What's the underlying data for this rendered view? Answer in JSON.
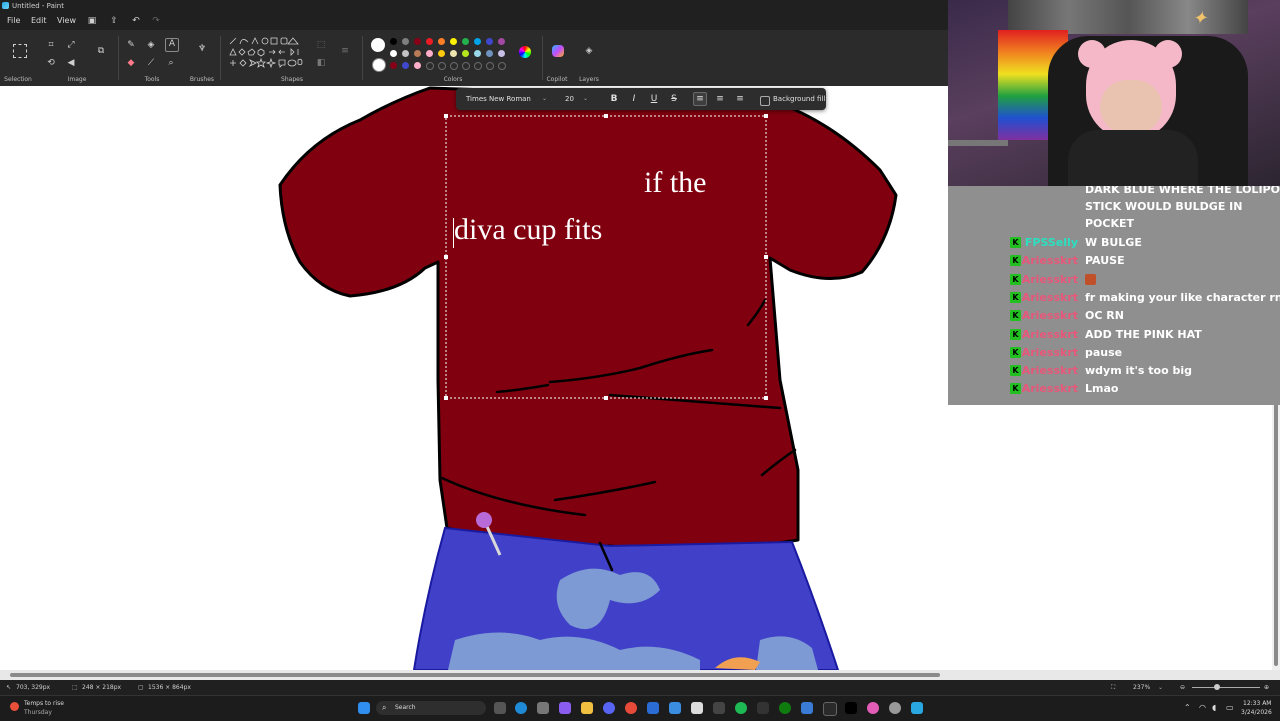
{
  "window": {
    "title": "Untitled - Paint"
  },
  "menu": {
    "file": "File",
    "edit": "Edit",
    "view": "View"
  },
  "ribbon": {
    "groups": {
      "selection": "Selection",
      "image": "Image",
      "tools": "Tools",
      "brushes": "Brushes",
      "shapes": "Shapes",
      "colors": "Colors",
      "copilot": "Copilot",
      "layers": "Layers"
    }
  },
  "palette": {
    "row1": [
      "#000000",
      "#7f7f7f",
      "#880015",
      "#ed1c24",
      "#ff7f27",
      "#fff200",
      "#22b14c",
      "#00a2e8",
      "#3f48cc",
      "#a349a4"
    ],
    "row2": [
      "#ffffff",
      "#c3c3c3",
      "#b97a57",
      "#ffaec9",
      "#ffc90e",
      "#efe4b0",
      "#b5e61d",
      "#99d9ea",
      "#7092be",
      "#c8bfe7"
    ],
    "row3": [
      "#880015",
      "#3f48cc",
      "#ffaec9"
    ]
  },
  "textbar": {
    "font": "Times New Roman",
    "size": "20",
    "background_fill": "Background fill"
  },
  "canvas": {
    "line1": "if the",
    "line2": "diva cup fits"
  },
  "status": {
    "cursor_pos": "703, 329px",
    "selection_size": "248 × 218px",
    "canvas_size": "1536 × 864px",
    "zoom": "237%"
  },
  "taskbar": {
    "weather_title": "Temps to rise",
    "weather_sub": "Thursday",
    "search": "Search",
    "time": "12:33 AM",
    "date": "3/24/2026"
  },
  "chat": {
    "continuation": [
      "DARK BLUE WHERE THE LOLIPOP",
      "STICK WOULD BULDGE IN",
      "POCKET"
    ],
    "messages": [
      {
        "user": "FPSSelly",
        "color": "#29e0c0",
        "text": "W BULGE"
      },
      {
        "user": "Ariesskrt",
        "color": "#e8577a",
        "text": "PAUSE"
      },
      {
        "user": "Ariesskrt",
        "color": "#e8577a",
        "text": ""
      },
      {
        "user": "Ariesskrt",
        "color": "#e8577a",
        "text": "fr making your like character rn"
      },
      {
        "user": "Ariesskrt",
        "color": "#e8577a",
        "text": "OC RN"
      },
      {
        "user": "Ariesskrt",
        "color": "#e8577a",
        "text": "ADD THE PINK HAT"
      },
      {
        "user": "Ariesskrt",
        "color": "#e8577a",
        "text": "pause"
      },
      {
        "user": "Ariesskrt",
        "color": "#e8577a",
        "text": "wdym it's too big"
      },
      {
        "user": "Ariesskrt",
        "color": "#e8577a",
        "text": "Lmao"
      }
    ]
  }
}
